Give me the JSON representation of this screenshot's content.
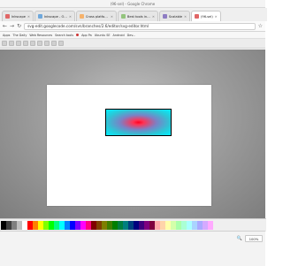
{
  "window": {
    "title": "(96-sel) - Google Chrome"
  },
  "tabs": [
    {
      "label": "Inkscape",
      "favicon_color": "#e06666"
    },
    {
      "label": "Inkscape - Open Source",
      "favicon_color": "#6fa8dc"
    },
    {
      "label": "Cross platform free sc",
      "favicon_color": "#f6b26b"
    },
    {
      "label": "Best tools in a 5 gi",
      "favicon_color": "#93c47d"
    },
    {
      "label": "Scalable",
      "favicon_color": "#8e7cc3"
    },
    {
      "label": "(96-sel)",
      "favicon_color": "#e06666",
      "active": true
    }
  ],
  "address_bar": {
    "url": "svg-edit.googlecode.com/svn/branches/2.6/editor/svg-editor.html"
  },
  "bookmarks": {
    "items": [
      "Apps",
      "The Daily",
      "Web Resources",
      "Search tools",
      "App Pa",
      "Ubuntu SE",
      "Android",
      "Dev..."
    ]
  },
  "zoom_level": "100",
  "status": {
    "left_text": "",
    "zoom_label": "100%",
    "stroke_label": "",
    "fill_label": ""
  },
  "palette_colors": [
    "#000000",
    "#3f3f3f",
    "#7f7f7f",
    "#bfbfbf",
    "#ffffff",
    "#ff0000",
    "#ff7f00",
    "#ffff00",
    "#7fff00",
    "#00ff00",
    "#00ff7f",
    "#00ffff",
    "#007fff",
    "#0000ff",
    "#7f00ff",
    "#ff00ff",
    "#ff007f",
    "#7f0000",
    "#7f3f00",
    "#7f7f00",
    "#3f7f00",
    "#007f00",
    "#007f3f",
    "#007f7f",
    "#003f7f",
    "#00007f",
    "#3f007f",
    "#7f007f",
    "#7f003f",
    "#ffaaaa",
    "#ffd4aa",
    "#ffffaa",
    "#d4ffaa",
    "#aaffaa",
    "#aaffd4",
    "#aaffff",
    "#aad4ff",
    "#aaaaff",
    "#d4aaff",
    "#ffaaff"
  ]
}
